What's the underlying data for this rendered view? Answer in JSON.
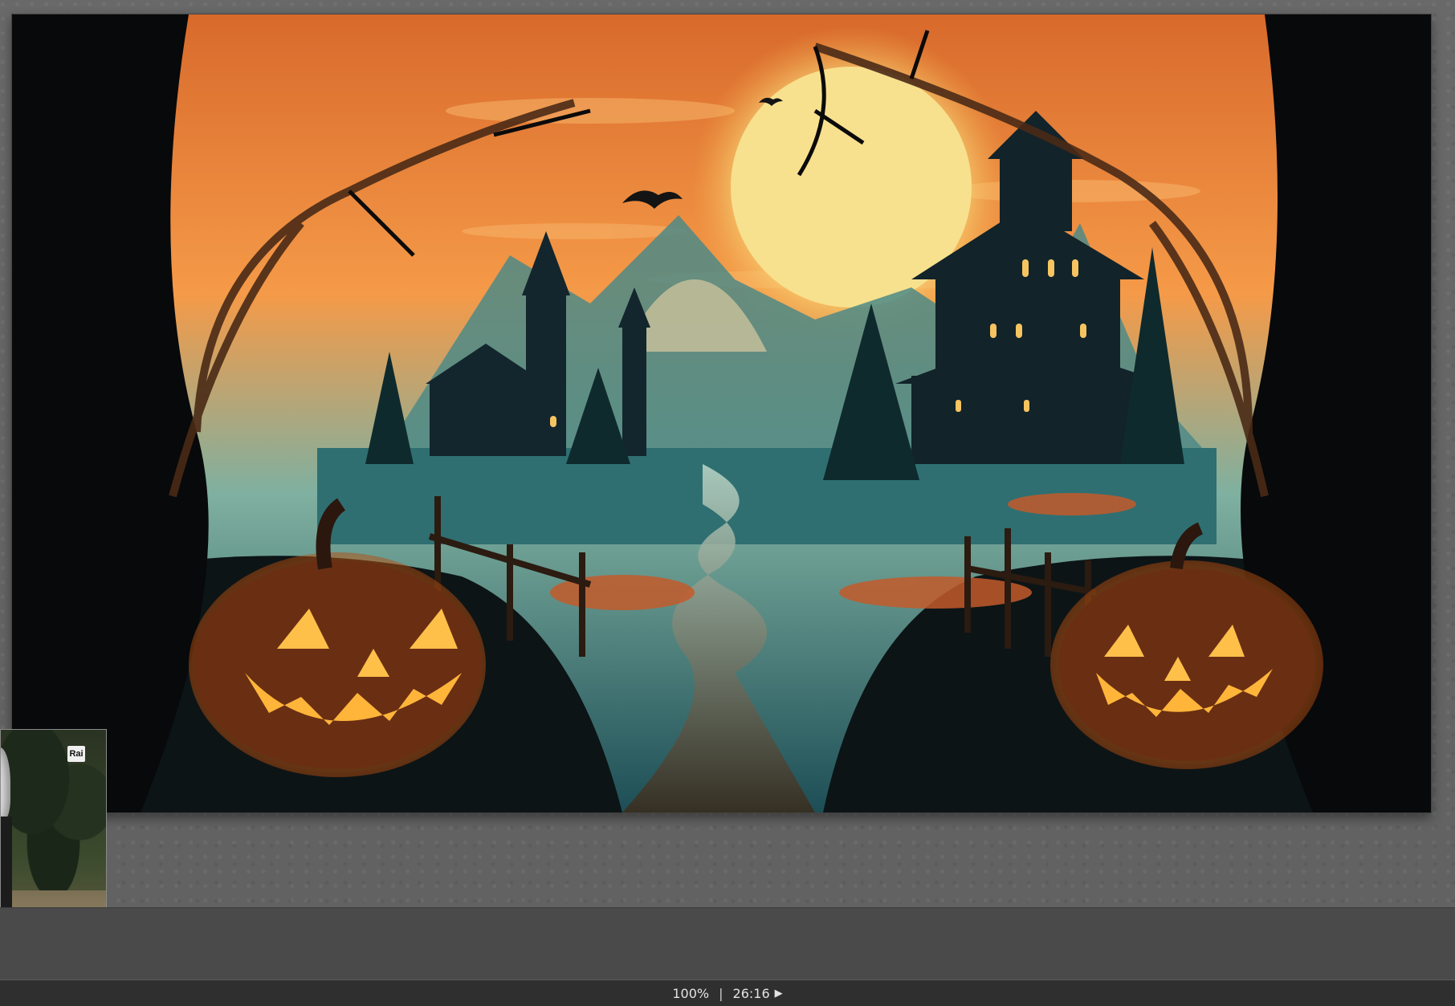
{
  "viewer": {
    "image": {
      "subject": "halloween-illustration",
      "palette": {
        "sky_orange": "#f2833a",
        "moon": "#f7df87",
        "teal": "#2f6a6a",
        "pumpkin": "#ff9d2c",
        "shadow": "#0b1215"
      }
    }
  },
  "thumbnail": {
    "badge": "Rai"
  },
  "status_bar": {
    "zoom": "100%",
    "separator": "|",
    "time": "26:16",
    "play_icon": "▶"
  }
}
